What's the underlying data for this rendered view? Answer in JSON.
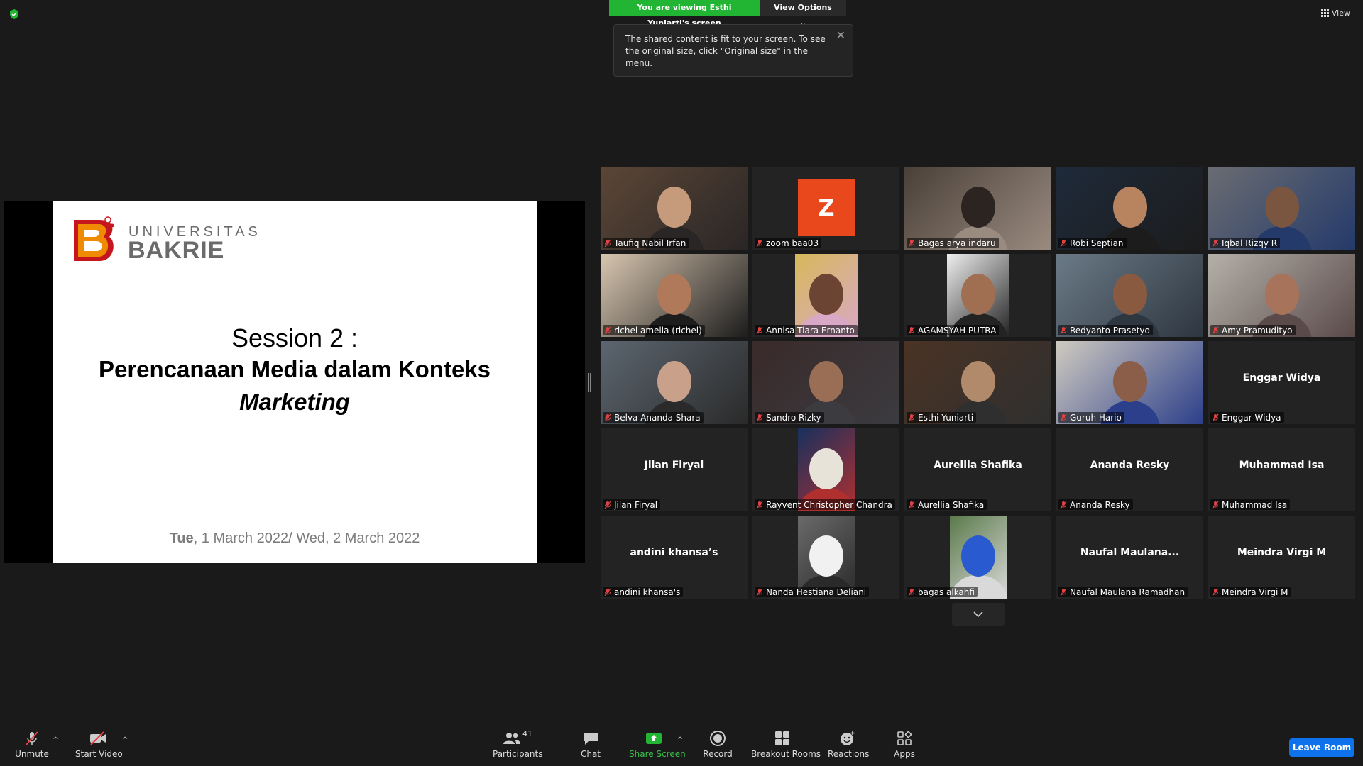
{
  "sharing": {
    "banner": "You are viewing Esthi Yuniarti's screen",
    "view_options": "View Options",
    "notice": "The shared content is fit to your screen. To see the original size, click \"Original size\" in the menu.",
    "close": "✕",
    "view_label": "View"
  },
  "slide": {
    "logo_line1": "UNIVERSITAS",
    "logo_line2": "BAKRIE",
    "title": "Session 2 :",
    "subtitle": "Perencanaan Media dalam Konteks",
    "subtitle_italic": "Marketing",
    "date_bold": "Tue",
    "date_rest": ", 1 March 2022/ Wed, 2 March 2022"
  },
  "participants": [
    {
      "name": "Taufiq Nabil Irfan",
      "tile": "video"
    },
    {
      "name": "zoom baa03",
      "tile": "avatar",
      "initial": "Z"
    },
    {
      "name": "Bagas arya indaru",
      "tile": "video"
    },
    {
      "name": "Robi Septian",
      "tile": "video"
    },
    {
      "name": "Iqbal Rizqy R",
      "tile": "video"
    },
    {
      "name": "richel amelia (richel)",
      "tile": "video"
    },
    {
      "name": "Annisa Tiara Ernanto",
      "tile": "video"
    },
    {
      "name": "AGAMSYAH PUTRA",
      "tile": "video"
    },
    {
      "name": "Redyanto Prasetyo",
      "tile": "video"
    },
    {
      "name": "Amy Pramudityo",
      "tile": "video"
    },
    {
      "name": "Belva Ananda Shara",
      "tile": "video"
    },
    {
      "name": "Sandro Rizky",
      "tile": "video"
    },
    {
      "name": "Esthi Yuniarti",
      "tile": "video",
      "active": true
    },
    {
      "name": "Guruh Hario",
      "tile": "video"
    },
    {
      "name": "Enggar Widya",
      "tile": "name",
      "center": "Enggar Widya"
    },
    {
      "name": "Jilan Firyal",
      "tile": "name",
      "center": "Jilan Firyal"
    },
    {
      "name": "Rayvent Christopher Chandra",
      "tile": "video"
    },
    {
      "name": "Aurellia Shafika",
      "tile": "name",
      "center": "Aurellia Shafika"
    },
    {
      "name": "Ananda Resky",
      "tile": "name",
      "center": "Ananda Resky"
    },
    {
      "name": "Muhammad Isa",
      "tile": "name",
      "center": "Muhammad Isa"
    },
    {
      "name": "andini khansa's",
      "tile": "name",
      "center": "andini khansa’s"
    },
    {
      "name": "Nanda Hestiana Deliani",
      "tile": "video"
    },
    {
      "name": "bagas alkahfi",
      "tile": "video"
    },
    {
      "name": "Naufal Maulana Ramadhan",
      "tile": "name",
      "center": "Naufal  Maulana..."
    },
    {
      "name": "Meindra Virgi M",
      "tile": "name",
      "center": "Meindra Virgi M"
    }
  ],
  "toolbar": {
    "unmute": "Unmute",
    "start_video": "Start Video",
    "participants": "Participants",
    "participants_count": "41",
    "chat": "Chat",
    "share_screen": "Share Screen",
    "record": "Record",
    "breakout_rooms": "Breakout Rooms",
    "reactions": "Reactions",
    "apps": "Apps",
    "leave": "Leave Room",
    "caret": "^"
  },
  "colors": {
    "share_green": "#21b533",
    "leave_blue": "#0e72ed",
    "avatar_orange": "#e8481c",
    "active_speaker": "#e6e67a",
    "muted_red": "#e04141"
  }
}
